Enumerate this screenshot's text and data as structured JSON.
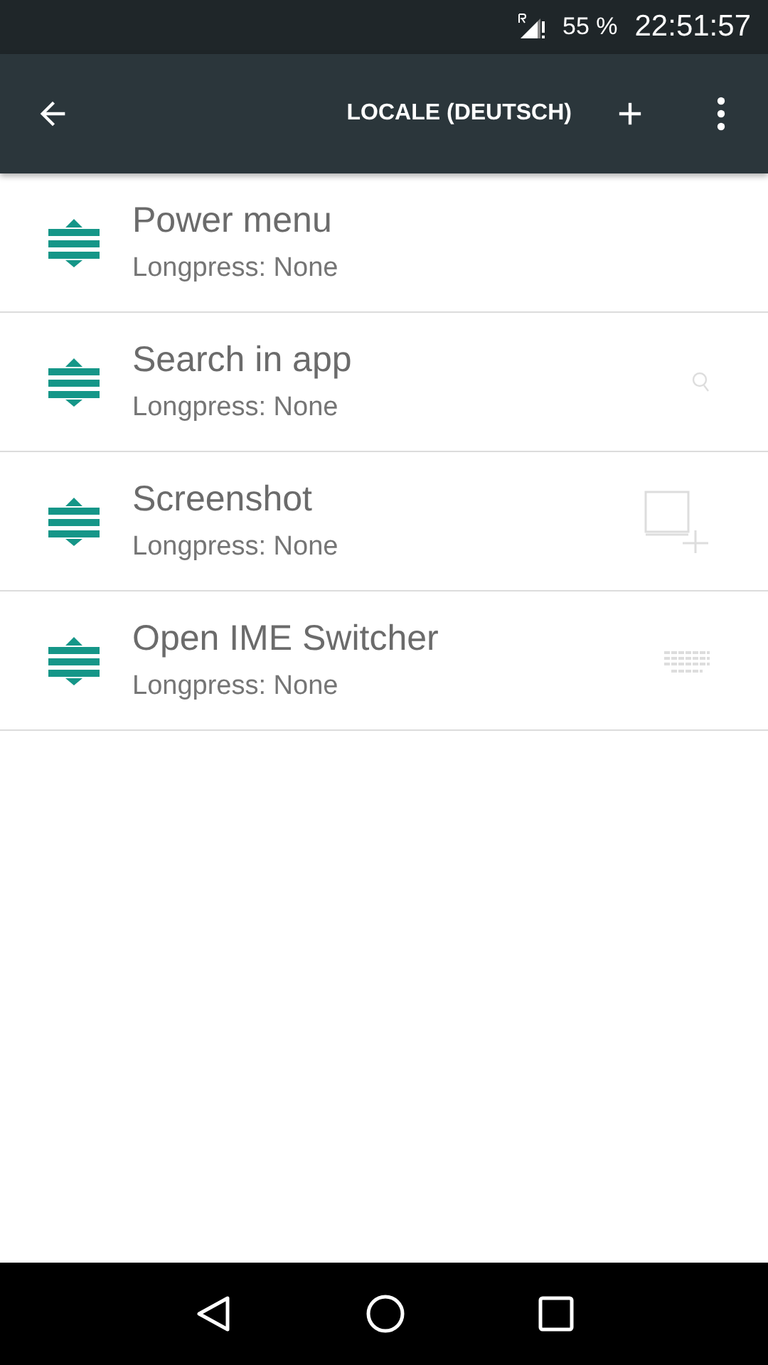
{
  "status_bar": {
    "battery": "55 %",
    "time": "22:51:57"
  },
  "toolbar": {
    "title": "LOCALE (DEUTSCH)"
  },
  "items": [
    {
      "title": "Power menu",
      "subtitle": "Longpress: None",
      "kind": "none"
    },
    {
      "title": "Search in app",
      "subtitle": "Longpress: None",
      "kind": "search"
    },
    {
      "title": "Screenshot",
      "subtitle": "Longpress: None",
      "kind": "screenshot"
    },
    {
      "title": "Open IME Switcher",
      "subtitle": "Longpress: None",
      "kind": "keyboard"
    }
  ]
}
